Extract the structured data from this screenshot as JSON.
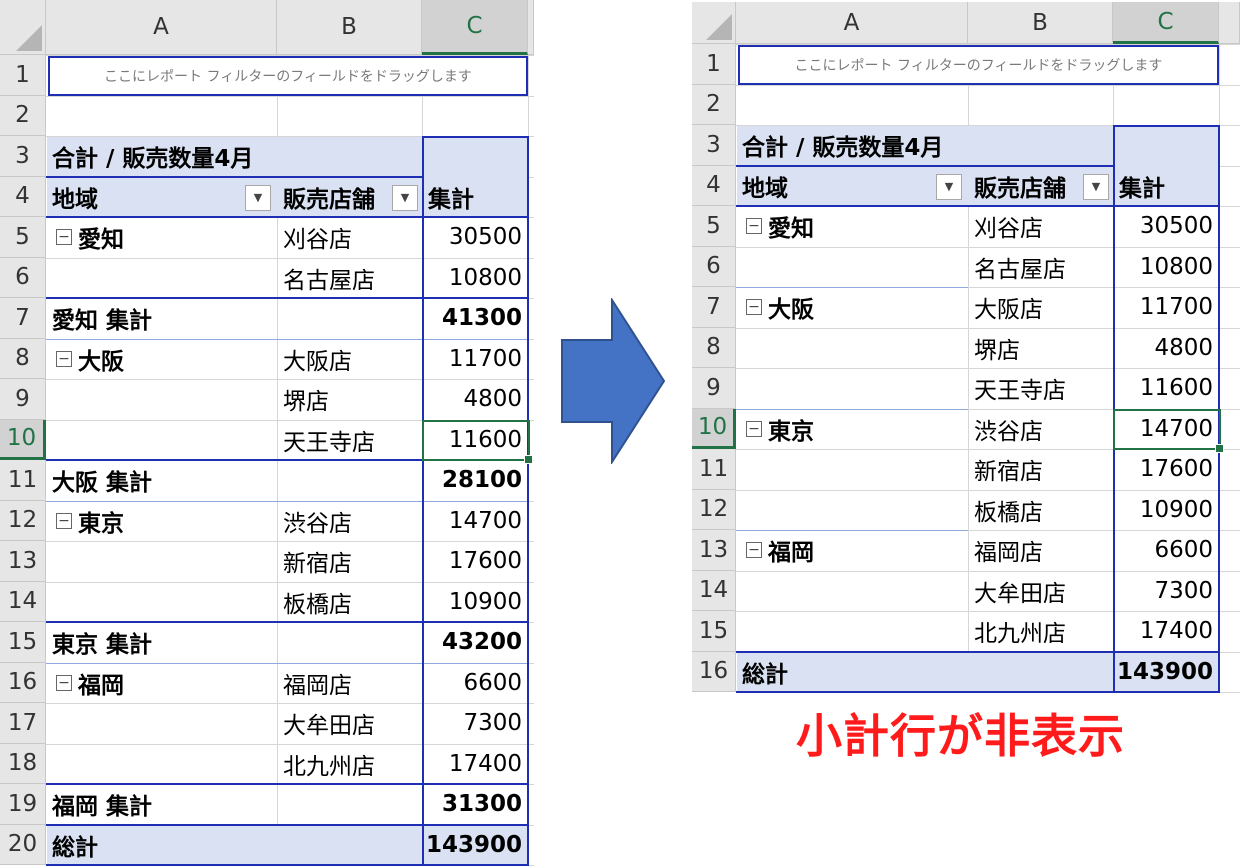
{
  "columns": [
    "A",
    "B",
    "C"
  ],
  "left": {
    "filter_placeholder": "ここにレポート フィルターのフィールドをドラッグします",
    "pivot_title": "合計 / 販売数量4月",
    "col_region": "地域",
    "col_store": "販売店舗",
    "col_total": "集計",
    "row_numbers": [
      "1",
      "2",
      "3",
      "4",
      "5",
      "6",
      "7",
      "8",
      "9",
      "10",
      "11",
      "12",
      "13",
      "14",
      "15",
      "16",
      "17",
      "18",
      "19",
      "20"
    ],
    "rows": [
      {
        "region": "愛知",
        "store": "刈谷店",
        "value": "30500",
        "type": "first"
      },
      {
        "region": "",
        "store": "名古屋店",
        "value": "10800",
        "type": "item"
      },
      {
        "region": "愛知 集計",
        "store": "",
        "value": "41300",
        "type": "subtotal"
      },
      {
        "region": "大阪",
        "store": "大阪店",
        "value": "11700",
        "type": "first"
      },
      {
        "region": "",
        "store": "堺店",
        "value": "4800",
        "type": "item"
      },
      {
        "region": "",
        "store": "天王寺店",
        "value": "11600",
        "type": "item"
      },
      {
        "region": "大阪 集計",
        "store": "",
        "value": "28100",
        "type": "subtotal"
      },
      {
        "region": "東京",
        "store": "渋谷店",
        "value": "14700",
        "type": "first"
      },
      {
        "region": "",
        "store": "新宿店",
        "value": "17600",
        "type": "item"
      },
      {
        "region": "",
        "store": "板橋店",
        "value": "10900",
        "type": "item"
      },
      {
        "region": "東京 集計",
        "store": "",
        "value": "43200",
        "type": "subtotal"
      },
      {
        "region": "福岡",
        "store": "福岡店",
        "value": "6600",
        "type": "first"
      },
      {
        "region": "",
        "store": "大牟田店",
        "value": "7300",
        "type": "item"
      },
      {
        "region": "",
        "store": "北九州店",
        "value": "17400",
        "type": "item"
      },
      {
        "region": "福岡 集計",
        "store": "",
        "value": "31300",
        "type": "subtotal"
      },
      {
        "region": "総計",
        "store": "",
        "value": "143900",
        "type": "grand"
      }
    ]
  },
  "right": {
    "filter_placeholder": "ここにレポート フィルターのフィールドをドラッグします",
    "pivot_title": "合計 / 販売数量4月",
    "col_region": "地域",
    "col_store": "販売店舗",
    "col_total": "集計",
    "row_numbers": [
      "1",
      "2",
      "3",
      "4",
      "5",
      "6",
      "7",
      "8",
      "9",
      "10",
      "11",
      "12",
      "13",
      "14",
      "15",
      "16"
    ],
    "rows": [
      {
        "region": "愛知",
        "store": "刈谷店",
        "value": "30500",
        "type": "first"
      },
      {
        "region": "",
        "store": "名古屋店",
        "value": "10800",
        "type": "item"
      },
      {
        "region": "大阪",
        "store": "大阪店",
        "value": "11700",
        "type": "first"
      },
      {
        "region": "",
        "store": "堺店",
        "value": "4800",
        "type": "item"
      },
      {
        "region": "",
        "store": "天王寺店",
        "value": "11600",
        "type": "item"
      },
      {
        "region": "東京",
        "store": "渋谷店",
        "value": "14700",
        "type": "first"
      },
      {
        "region": "",
        "store": "新宿店",
        "value": "17600",
        "type": "item"
      },
      {
        "region": "",
        "store": "板橋店",
        "value": "10900",
        "type": "item"
      },
      {
        "region": "福岡",
        "store": "福岡店",
        "value": "6600",
        "type": "first"
      },
      {
        "region": "",
        "store": "大牟田店",
        "value": "7300",
        "type": "item"
      },
      {
        "region": "",
        "store": "北九州店",
        "value": "17400",
        "type": "item"
      },
      {
        "region": "総計",
        "store": "",
        "value": "143900",
        "type": "grand"
      }
    ]
  },
  "caption": "小計行が非表示",
  "colors": {
    "pivot_border": "#1e2fb4",
    "header_band": "#d9e1f2",
    "selection": "#217346",
    "caption": "#ff1b1b",
    "arrow": "#4472c4"
  }
}
